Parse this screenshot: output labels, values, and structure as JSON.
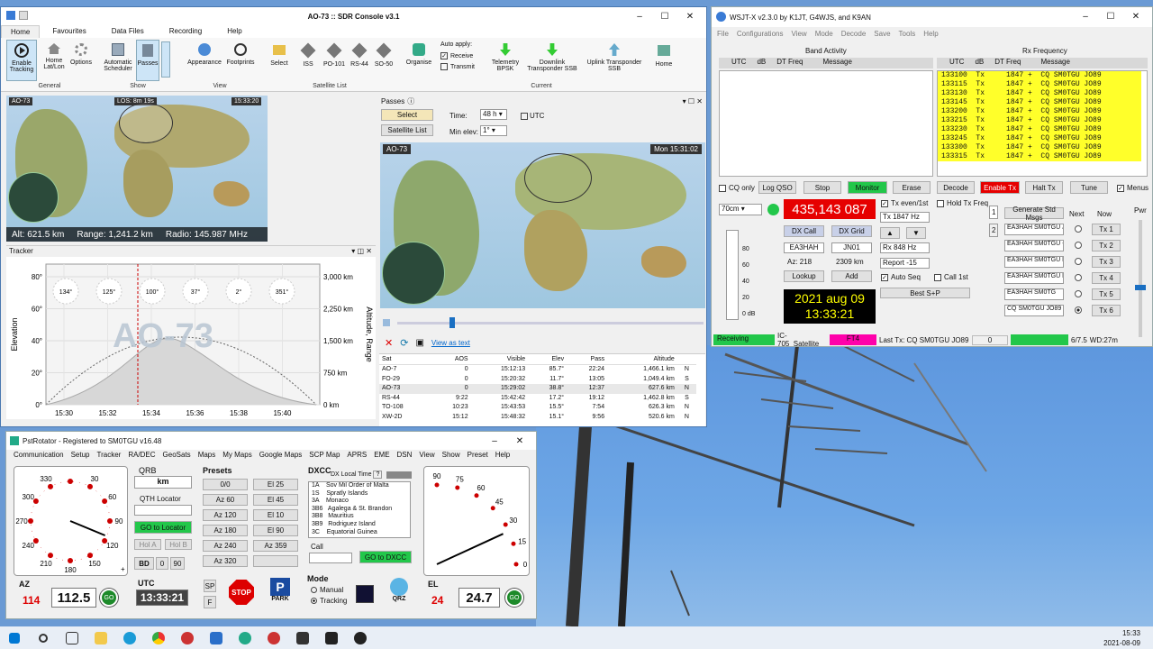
{
  "sdr": {
    "title": "AO-73 :: SDR Console v3.1",
    "tabs": [
      "Home",
      "Favourites",
      "Data Files",
      "Recording",
      "Help"
    ],
    "ribbon": {
      "enable_tracking": "Enable Tracking",
      "home_latlon": "Home Lat/Lon",
      "options": "Options",
      "auto_scheduler": "Automatic Scheduler",
      "passes": "Passes",
      "appearance": "Appearance",
      "footprints": "Footprints",
      "select": "Select",
      "iss": "ISS",
      "po101": "PO-101",
      "rs44": "RS-44",
      "so50": "SO-50",
      "organise": "Organise",
      "auto_apply": "Auto apply:",
      "receive": "Receive",
      "transmit": "Transmit",
      "telemetry": "Telemetry BPSK",
      "downlink": "Downlink Transponder SSB",
      "uplink": "Uplink Transponder SSB",
      "home": "Home"
    },
    "groups": [
      "General",
      "Show",
      "View",
      "Satellite List",
      "Current"
    ],
    "map": {
      "sat": "AO-73",
      "los": "LOS: 8m 19s",
      "time": "15:33:20",
      "alt": "Alt: 621.5 km",
      "range": "Range: 1,241.2 km",
      "radio": "Radio: 145.987 MHz"
    },
    "tracker": {
      "title": "Tracker",
      "sat": "AO-73",
      "ylabel": "Elevation",
      "y2label": "Altitude, Range",
      "yticks": [
        "80°",
        "60°",
        "40°",
        "20°",
        "0°"
      ],
      "y2ticks": [
        "3,000 km",
        "2,250 km",
        "1,500 km",
        "750 km",
        "0 km"
      ],
      "xticks": [
        "15:30",
        "15:32",
        "15:34",
        "15:36",
        "15:38",
        "15:40"
      ],
      "az": [
        "134°",
        "125°",
        "100°",
        "37°",
        "2°",
        "351°"
      ]
    },
    "passes": {
      "title": "Passes",
      "select": "Select",
      "satlist": "Satellite List",
      "time_label": "Time:",
      "time_val": "48 h",
      "utc": "UTC",
      "minelev_label": "Min elev:",
      "minelev_val": "1°",
      "sat": "AO-73",
      "clock": "Mon 15:31:02",
      "view_as_text": "View as text",
      "headers": [
        "Sat",
        "AOS",
        "Visible",
        "Elev",
        "Pass",
        "Altitude",
        ""
      ],
      "rows": [
        [
          "AO-7",
          "0",
          "15:12:13",
          "85.7°",
          "22:24",
          "1,466.1 km",
          "N"
        ],
        [
          "FO-29",
          "0",
          "15:20:32",
          "11.7°",
          "13:05",
          "1,049.4 km",
          "S"
        ],
        [
          "AO-73",
          "0",
          "15:29:02",
          "38.8°",
          "12:37",
          "627.6 km",
          "N"
        ],
        [
          "RS-44",
          "9:22",
          "15:42:42",
          "17.2°",
          "19:12",
          "1,462.8 km",
          "S"
        ],
        [
          "TO-108",
          "10:23",
          "15:43:53",
          "15.5°",
          "7:54",
          "626.3 km",
          "N"
        ],
        [
          "XW-2D",
          "15:12",
          "15:48:32",
          "15.1°",
          "9:56",
          "520.6 km",
          "N"
        ]
      ]
    }
  },
  "wsjt": {
    "title": "WSJT-X  v2.3.0  by K1JT, G4WJS, and K9AN",
    "menu": [
      "File",
      "Configurations",
      "View",
      "Mode",
      "Decode",
      "Save",
      "Tools",
      "Help"
    ],
    "band_activity": "Band Activity",
    "rx_frequency": "Rx Frequency",
    "cols": [
      "UTC",
      "dB",
      "DT Freq",
      "Message"
    ],
    "rx_rows": [
      "133100  Tx     1847 +  CQ SM0TGU JO89",
      "133115  Tx     1847 +  CQ SM0TGU JO89",
      "133130  Tx     1847 +  CQ SM0TGU JO89",
      "133145  Tx     1847 +  CQ SM0TGU JO89",
      "133200  Tx     1847 +  CQ SM0TGU JO89",
      "133215  Tx     1847 +  CQ SM0TGU JO89",
      "133230  Tx     1847 +  CQ SM0TGU JO89",
      "133245  Tx     1847 +  CQ SM0TGU JO89",
      "133300  Tx     1847 +  CQ SM0TGU JO89",
      "133315  Tx     1847 +  CQ SM0TGU JO89"
    ],
    "buttons": {
      "cq_only": "CQ only",
      "log_qso": "Log QSO",
      "stop": "Stop",
      "monitor": "Monitor",
      "erase": "Erase",
      "decode": "Decode",
      "enable_tx": "Enable Tx",
      "halt_tx": "Halt Tx",
      "tune": "Tune",
      "menus": "Menus"
    },
    "band": "70cm",
    "freq": "435,143 087",
    "tx_even": "Tx even/1st",
    "hold_tx": "Hold Tx Freq",
    "tx_hz": "Tx  1847 Hz",
    "rx_hz": "Rx  848  Hz",
    "report": "Report -15",
    "auto_seq": "Auto Seq",
    "call_1st": "Call 1st",
    "best_sp": "Best S+P",
    "dx_call_btn": "DX Call",
    "dx_grid_btn": "DX Grid",
    "dx_call": "EA3HAH",
    "dx_grid": "JN01",
    "az": "Az: 218",
    "dist": "2309 km",
    "lookup": "Lookup",
    "add": "Add",
    "date": "2021 aug 09",
    "time": "13:33:21",
    "gen_std": "Generate Std Msgs",
    "next": "Next",
    "now": "Now",
    "pwr": "Pwr",
    "msgs": [
      "EA3HAH SM0TGU JO",
      "EA3HAH SM0TGU -1",
      "EA3HAH SM0TGU R-",
      "EA3HAH SM0TGU RF",
      "EA3HAH SM0TG",
      "CQ SM0TGU JO89"
    ],
    "tx_btns": [
      "Tx 1",
      "Tx 2",
      "Tx 3",
      "Tx 4",
      "Tx 5",
      "Tx 6"
    ],
    "meter": [
      "80",
      "60",
      "40",
      "20",
      "0 dB"
    ],
    "status": {
      "receiving": "Receiving",
      "rig": "IC-705_Satellite",
      "mode": "FT4",
      "last_tx": "Last Tx: CQ SM0TGU JO89",
      "zero": "0",
      "ratio": "6/7.5",
      "wd": "WD:27m"
    },
    "tab1": "1",
    "tab2": "2"
  },
  "rot": {
    "title": "PstRotator - Registered to SM0TGU  v16.48",
    "menu": [
      "Communication",
      "Setup",
      "Tracker",
      "RA/DEC",
      "GeoSats",
      "Maps",
      "My Maps",
      "Google Maps",
      "SCP Map",
      "APRS",
      "EME",
      "DSN",
      "View",
      "Show",
      "Preset",
      "Help"
    ],
    "qrb": "QRB",
    "km": "km",
    "qth_locator": "QTH Locator",
    "go_locator": "GO to Locator",
    "hol_a": "Hol A",
    "hol_b": "Hol B",
    "bd": "BD",
    "bd0": "0",
    "bd90": "90",
    "presets": "Presets",
    "preset_btns": [
      "0/0",
      "El 25",
      "Az 60",
      "El 45",
      "Az 120",
      "El 10",
      "Az 180",
      "El 90",
      "Az 240",
      "Az 359",
      "Az 320",
      ""
    ],
    "dxcc": "DXCC",
    "dx_local": "DX Local Time",
    "dx_q": "?",
    "dxcc_list": [
      "1A    Sov Mil Order of Malta",
      "1S    Spratly Islands",
      "3A    Monaco",
      "3B6   Agalega & St. Brandon",
      "3B8   Mauritius",
      "3B9   Rodriguez Island",
      "3C    Equatorial Guinea"
    ],
    "call": "Call",
    "go_dxcc": "GO to DXCC",
    "az_label": "AZ",
    "az_set": "114",
    "az_val": "112.5",
    "go": "GO",
    "utc_label": "UTC",
    "utc": "13:33:21",
    "sp": "SP",
    "f": "F",
    "stop": "STOP",
    "park": "PARK",
    "mode": "Mode",
    "manual": "Manual",
    "tracking": "Tracking",
    "qrz": "QRZ",
    "el_label": "EL",
    "el_set": "24",
    "el_val": "24.7",
    "az_ticks": [
      "330",
      "30",
      "300",
      "60",
      "270",
      "90",
      "240",
      "120",
      "210",
      "150",
      "180"
    ],
    "el_ticks": [
      "90",
      "75",
      "60",
      "45",
      "30",
      "15",
      "0"
    ],
    "az_needle": 112.5,
    "el_needle": 24.7
  },
  "clock": {
    "time": "15:33",
    "date": "2021-08-09"
  },
  "colors": {
    "yellow": "#ffff2a",
    "red": "#e60000",
    "green": "#22c74a",
    "magenta": "#ff00aa",
    "lcd_green": "#00a500",
    "navy": "#000000"
  }
}
